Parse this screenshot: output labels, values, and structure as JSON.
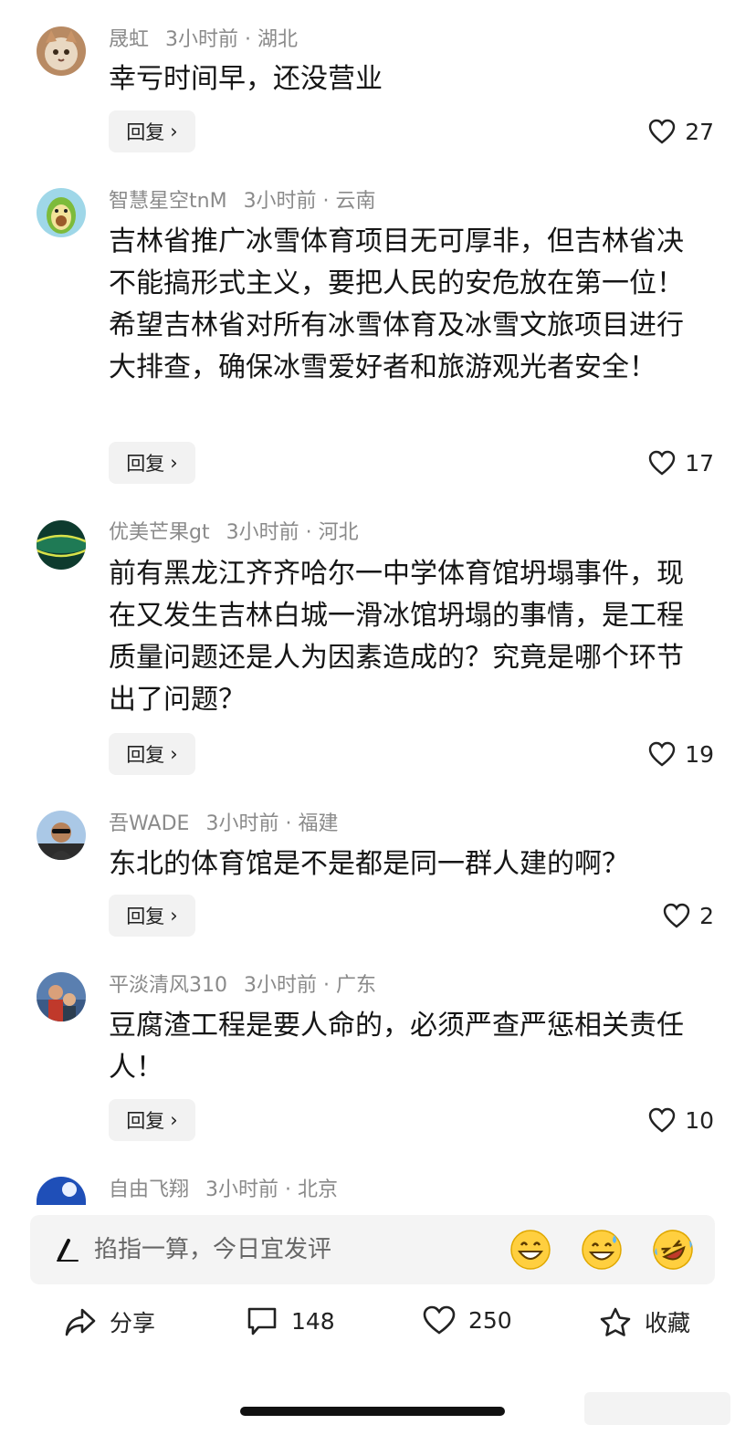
{
  "comments": [
    {
      "name": "晟虹",
      "time": "3小时前",
      "location": "湖北",
      "text": "幸亏时间早，还没营业",
      "reply_label": "回复",
      "likes": "27"
    },
    {
      "name": "智慧星空tnM",
      "time": "3小时前",
      "location": "云南",
      "text": "吉林省推广冰雪体育项目无可厚非，但吉林省决不能搞形式主义，要把人民的安危放在第一位！希望吉林省对所有冰雪体育及冰雪文旅项目进行大排查，确保冰雪爱好者和旅游观光者安全！",
      "reply_label": "回复",
      "likes": "17"
    },
    {
      "name": "优美芒果gt",
      "time": "3小时前",
      "location": "河北",
      "text": "前有黑龙江齐齐哈尔一中学体育馆坍塌事件，现在又发生吉林白城一滑冰馆坍塌的事情，是工程质量问题还是人为因素造成的？究竟是哪个环节出了问题？",
      "reply_label": "回复",
      "likes": "19"
    },
    {
      "name": "吾WADE",
      "time": "3小时前",
      "location": "福建",
      "text": "东北的体育馆是不是都是同一群人建的啊？",
      "reply_label": "回复",
      "likes": "2"
    },
    {
      "name": "平淡清风310",
      "time": "3小时前",
      "location": "广东",
      "text": "豆腐渣工程是要人命的，必须严查严惩相关责任人！",
      "reply_label": "回复",
      "likes": "10"
    },
    {
      "name": "自由飞翔",
      "time": "3小时前",
      "location": "北京"
    }
  ],
  "input": {
    "placeholder": "掐指一算，今日宜发评"
  },
  "bottom": {
    "share_label": "分享",
    "comment_count": "148",
    "like_count": "250",
    "collect_label": "收藏"
  },
  "colors": {
    "meta_gray": "#8a8a8a",
    "reply_bg": "#f2f2f2",
    "input_bg": "#f4f4f4"
  }
}
